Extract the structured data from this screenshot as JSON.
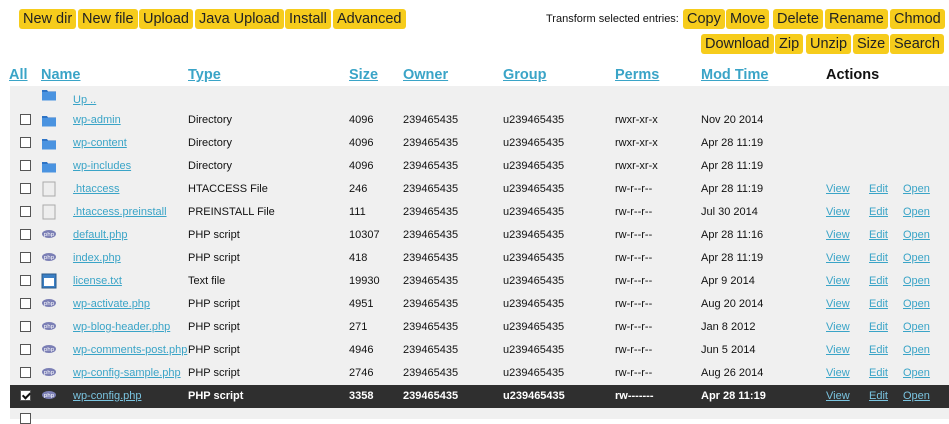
{
  "toolbar": {
    "buttons": [
      "New dir",
      "New file",
      "Upload",
      "Java Upload",
      "Install",
      "Advanced"
    ],
    "transform_label": "Transform selected entries:",
    "transform_buttons": [
      "Copy",
      "Move",
      "Delete",
      "Rename",
      "Chmod",
      "Download",
      "Zip",
      "Unzip",
      "Size",
      "Search"
    ]
  },
  "headers": {
    "all": "All",
    "name": "Name",
    "type": "Type",
    "size": "Size",
    "owner": "Owner",
    "group": "Group",
    "perms": "Perms",
    "mtime": "Mod Time",
    "actions": "Actions"
  },
  "up_label": "Up ..",
  "action_labels": {
    "view": "View",
    "edit": "Edit",
    "open": "Open"
  },
  "colors": {
    "button": "#f6cc1c",
    "link": "#3aa4c7",
    "selected_row": "#2f2f2f",
    "table_bg": "#f0f0f0"
  },
  "files": [
    {
      "name": "wp-admin",
      "type": "Directory",
      "size": "4096",
      "owner": "239465435",
      "group": "u239465435",
      "perms": "rwxr-xr-x",
      "mtime": "Nov 20 2014",
      "icon": "folder-icon",
      "actions": false,
      "selected": false
    },
    {
      "name": "wp-content",
      "type": "Directory",
      "size": "4096",
      "owner": "239465435",
      "group": "u239465435",
      "perms": "rwxr-xr-x",
      "mtime": "Apr 28 11:19",
      "icon": "folder-icon",
      "actions": false,
      "selected": false
    },
    {
      "name": "wp-includes",
      "type": "Directory",
      "size": "4096",
      "owner": "239465435",
      "group": "u239465435",
      "perms": "rwxr-xr-x",
      "mtime": "Apr 28 11:19",
      "icon": "folder-icon",
      "actions": false,
      "selected": false
    },
    {
      "name": ".htaccess",
      "type": "HTACCESS File",
      "size": "246",
      "owner": "239465435",
      "group": "u239465435",
      "perms": "rw-r--r--",
      "mtime": "Apr 28 11:19",
      "icon": "file-icon",
      "actions": true,
      "selected": false
    },
    {
      "name": ".htaccess.preinstall",
      "type": "PREINSTALL File",
      "size": "111",
      "owner": "239465435",
      "group": "u239465435",
      "perms": "rw-r--r--",
      "mtime": "Jul 30 2014",
      "icon": "file-icon",
      "actions": true,
      "selected": false
    },
    {
      "name": "default.php",
      "type": "PHP script",
      "size": "10307",
      "owner": "239465435",
      "group": "u239465435",
      "perms": "rw-r--r--",
      "mtime": "Apr 28 11:16",
      "icon": "php-icon",
      "actions": true,
      "selected": false
    },
    {
      "name": "index.php",
      "type": "PHP script",
      "size": "418",
      "owner": "239465435",
      "group": "u239465435",
      "perms": "rw-r--r--",
      "mtime": "Apr 28 11:19",
      "icon": "php-icon",
      "actions": true,
      "selected": false
    },
    {
      "name": "license.txt",
      "type": "Text file",
      "size": "19930",
      "owner": "239465435",
      "group": "u239465435",
      "perms": "rw-r--r--",
      "mtime": "Apr 9 2014",
      "icon": "text-file-icon",
      "actions": true,
      "selected": false
    },
    {
      "name": "wp-activate.php",
      "type": "PHP script",
      "size": "4951",
      "owner": "239465435",
      "group": "u239465435",
      "perms": "rw-r--r--",
      "mtime": "Aug 20 2014",
      "icon": "php-icon",
      "actions": true,
      "selected": false
    },
    {
      "name": "wp-blog-header.php",
      "type": "PHP script",
      "size": "271",
      "owner": "239465435",
      "group": "u239465435",
      "perms": "rw-r--r--",
      "mtime": "Jan 8 2012",
      "icon": "php-icon",
      "actions": true,
      "selected": false
    },
    {
      "name": "wp-comments-post.php",
      "type": "PHP script",
      "size": "4946",
      "owner": "239465435",
      "group": "u239465435",
      "perms": "rw-r--r--",
      "mtime": "Jun 5 2014",
      "icon": "php-icon",
      "actions": true,
      "selected": false
    },
    {
      "name": "wp-config-sample.php",
      "type": "PHP script",
      "size": "2746",
      "owner": "239465435",
      "group": "u239465435",
      "perms": "rw-r--r--",
      "mtime": "Aug 26 2014",
      "icon": "php-icon",
      "actions": true,
      "selected": false
    },
    {
      "name": "wp-config.php",
      "type": "PHP script",
      "size": "3358",
      "owner": "239465435",
      "group": "u239465435",
      "perms": "rw-------",
      "mtime": "Apr 28 11:19",
      "icon": "php-icon",
      "actions": true,
      "selected": true
    }
  ]
}
